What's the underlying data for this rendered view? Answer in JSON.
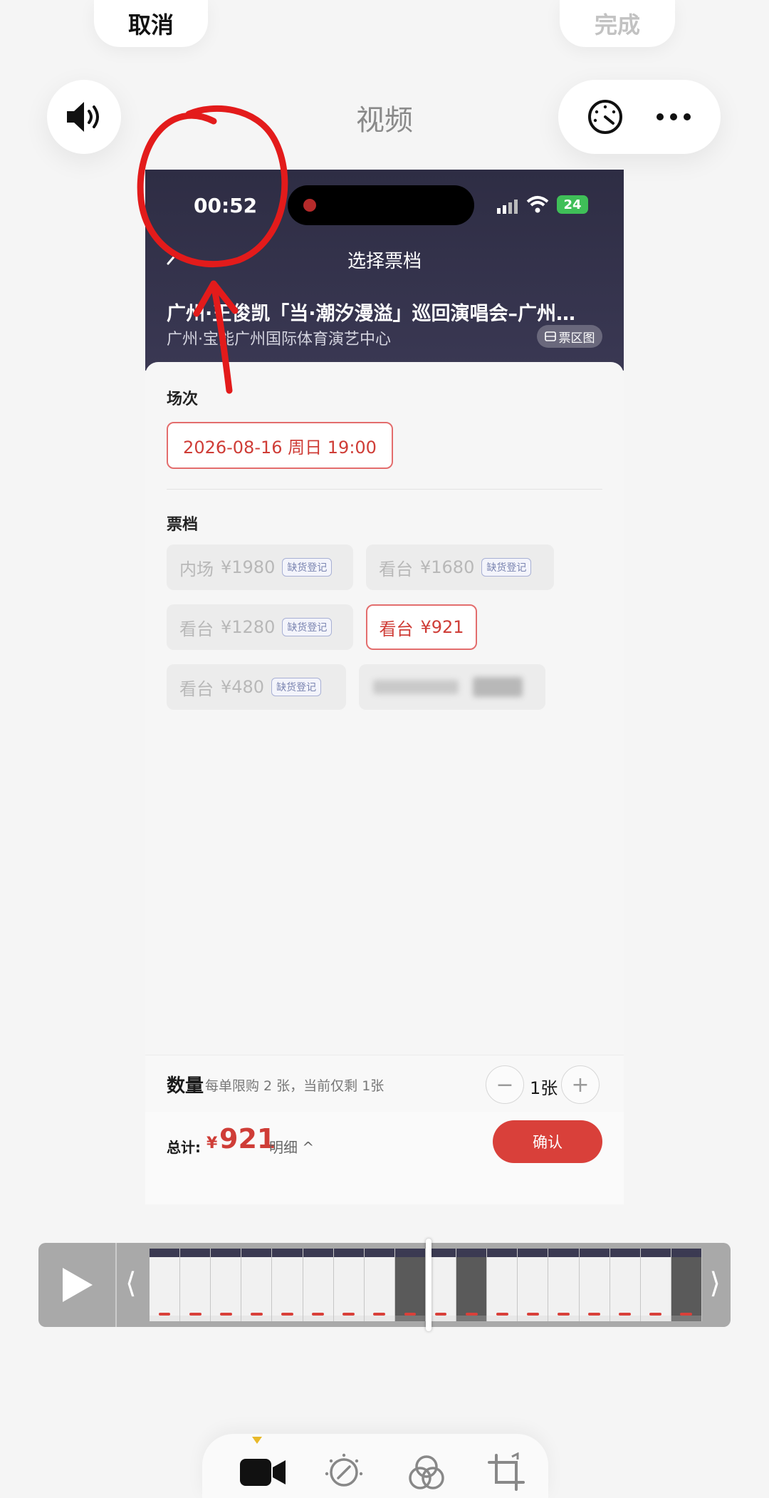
{
  "editor": {
    "cancel_label": "取消",
    "done_label": "完成",
    "title": "视频"
  },
  "phone": {
    "status_time": "00:52",
    "battery": "24",
    "nav_title": "选择票档",
    "event_title": "广州·王俊凯「当·潮汐漫溢」巡回演唱会–广州…",
    "venue": "广州·宝能广州国际体育演艺中心",
    "seat_map_label": "票区图",
    "session_label": "场次",
    "session_value": "2026-08-16 周日 19:00",
    "tier_label": "票档",
    "tiers": [
      {
        "name": "内场",
        "price": "¥1980",
        "badge": "缺货登记"
      },
      {
        "name": "看台",
        "price": "¥1680",
        "badge": "缺货登记"
      },
      {
        "name": "看台",
        "price": "¥1280",
        "badge": "缺货登记"
      },
      {
        "name": "看台",
        "price": "¥921",
        "badge": ""
      },
      {
        "name": "看台",
        "price": "¥480",
        "badge": "缺货登记"
      }
    ],
    "qty_label": "数量",
    "qty_note": "每单限购 2 张，当前仅剩 1张",
    "qty_minus": "−",
    "qty_plus": "+",
    "qty_value": "1张",
    "total_label": "总计:",
    "total_currency": "¥",
    "total_amount": "921",
    "detail_label": "明细 ^",
    "confirm_label": "确认"
  },
  "icons": {
    "volume": "volume-icon",
    "speed": "speedometer-icon",
    "more": "more-icon",
    "video": "video-camera-icon",
    "adjust": "adjust-icon",
    "filters": "filters-icon",
    "crop": "crop-icon"
  },
  "colors": {
    "accent_red": "#d9403a",
    "header_dark": "#2e2d44",
    "annotation_red": "#e31b1b",
    "marker_yellow": "#e8b92a"
  }
}
